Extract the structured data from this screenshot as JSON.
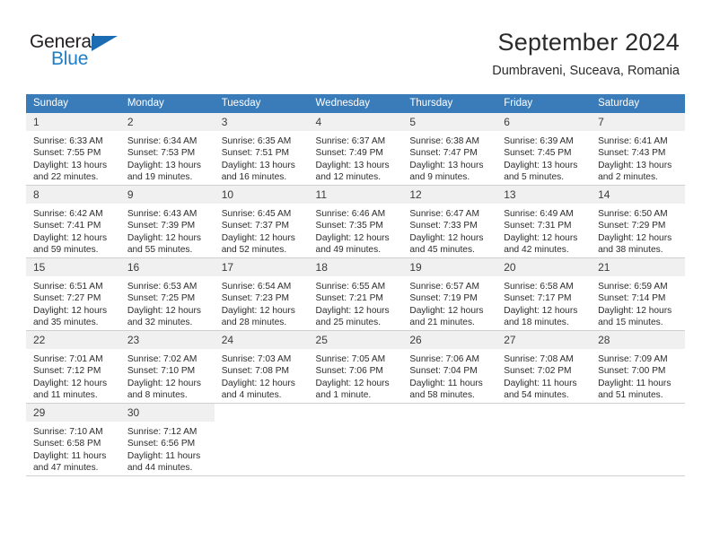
{
  "brand": {
    "name_dark": "General",
    "name_blue": "Blue",
    "flag_icon": "blue-triangle-flag",
    "dark_color": "#231f20",
    "blue_color": "#1f7ec4"
  },
  "header": {
    "title": "September 2024",
    "subtitle": "Dumbraveni, Suceava, Romania"
  },
  "theme": {
    "header_blue": "#3a7cb9",
    "daynum_bg": "#f0f0f0",
    "row_border": "#cfcfcf"
  },
  "weekday_headers": [
    "Sunday",
    "Monday",
    "Tuesday",
    "Wednesday",
    "Thursday",
    "Friday",
    "Saturday"
  ],
  "weeks": [
    [
      {
        "day": "1",
        "sunrise": "Sunrise: 6:33 AM",
        "sunset": "Sunset: 7:55 PM",
        "daylight": "Daylight: 13 hours and 22 minutes."
      },
      {
        "day": "2",
        "sunrise": "Sunrise: 6:34 AM",
        "sunset": "Sunset: 7:53 PM",
        "daylight": "Daylight: 13 hours and 19 minutes."
      },
      {
        "day": "3",
        "sunrise": "Sunrise: 6:35 AM",
        "sunset": "Sunset: 7:51 PM",
        "daylight": "Daylight: 13 hours and 16 minutes."
      },
      {
        "day": "4",
        "sunrise": "Sunrise: 6:37 AM",
        "sunset": "Sunset: 7:49 PM",
        "daylight": "Daylight: 13 hours and 12 minutes."
      },
      {
        "day": "5",
        "sunrise": "Sunrise: 6:38 AM",
        "sunset": "Sunset: 7:47 PM",
        "daylight": "Daylight: 13 hours and 9 minutes."
      },
      {
        "day": "6",
        "sunrise": "Sunrise: 6:39 AM",
        "sunset": "Sunset: 7:45 PM",
        "daylight": "Daylight: 13 hours and 5 minutes."
      },
      {
        "day": "7",
        "sunrise": "Sunrise: 6:41 AM",
        "sunset": "Sunset: 7:43 PM",
        "daylight": "Daylight: 13 hours and 2 minutes."
      }
    ],
    [
      {
        "day": "8",
        "sunrise": "Sunrise: 6:42 AM",
        "sunset": "Sunset: 7:41 PM",
        "daylight": "Daylight: 12 hours and 59 minutes."
      },
      {
        "day": "9",
        "sunrise": "Sunrise: 6:43 AM",
        "sunset": "Sunset: 7:39 PM",
        "daylight": "Daylight: 12 hours and 55 minutes."
      },
      {
        "day": "10",
        "sunrise": "Sunrise: 6:45 AM",
        "sunset": "Sunset: 7:37 PM",
        "daylight": "Daylight: 12 hours and 52 minutes."
      },
      {
        "day": "11",
        "sunrise": "Sunrise: 6:46 AM",
        "sunset": "Sunset: 7:35 PM",
        "daylight": "Daylight: 12 hours and 49 minutes."
      },
      {
        "day": "12",
        "sunrise": "Sunrise: 6:47 AM",
        "sunset": "Sunset: 7:33 PM",
        "daylight": "Daylight: 12 hours and 45 minutes."
      },
      {
        "day": "13",
        "sunrise": "Sunrise: 6:49 AM",
        "sunset": "Sunset: 7:31 PM",
        "daylight": "Daylight: 12 hours and 42 minutes."
      },
      {
        "day": "14",
        "sunrise": "Sunrise: 6:50 AM",
        "sunset": "Sunset: 7:29 PM",
        "daylight": "Daylight: 12 hours and 38 minutes."
      }
    ],
    [
      {
        "day": "15",
        "sunrise": "Sunrise: 6:51 AM",
        "sunset": "Sunset: 7:27 PM",
        "daylight": "Daylight: 12 hours and 35 minutes."
      },
      {
        "day": "16",
        "sunrise": "Sunrise: 6:53 AM",
        "sunset": "Sunset: 7:25 PM",
        "daylight": "Daylight: 12 hours and 32 minutes."
      },
      {
        "day": "17",
        "sunrise": "Sunrise: 6:54 AM",
        "sunset": "Sunset: 7:23 PM",
        "daylight": "Daylight: 12 hours and 28 minutes."
      },
      {
        "day": "18",
        "sunrise": "Sunrise: 6:55 AM",
        "sunset": "Sunset: 7:21 PM",
        "daylight": "Daylight: 12 hours and 25 minutes."
      },
      {
        "day": "19",
        "sunrise": "Sunrise: 6:57 AM",
        "sunset": "Sunset: 7:19 PM",
        "daylight": "Daylight: 12 hours and 21 minutes."
      },
      {
        "day": "20",
        "sunrise": "Sunrise: 6:58 AM",
        "sunset": "Sunset: 7:17 PM",
        "daylight": "Daylight: 12 hours and 18 minutes."
      },
      {
        "day": "21",
        "sunrise": "Sunrise: 6:59 AM",
        "sunset": "Sunset: 7:14 PM",
        "daylight": "Daylight: 12 hours and 15 minutes."
      }
    ],
    [
      {
        "day": "22",
        "sunrise": "Sunrise: 7:01 AM",
        "sunset": "Sunset: 7:12 PM",
        "daylight": "Daylight: 12 hours and 11 minutes."
      },
      {
        "day": "23",
        "sunrise": "Sunrise: 7:02 AM",
        "sunset": "Sunset: 7:10 PM",
        "daylight": "Daylight: 12 hours and 8 minutes."
      },
      {
        "day": "24",
        "sunrise": "Sunrise: 7:03 AM",
        "sunset": "Sunset: 7:08 PM",
        "daylight": "Daylight: 12 hours and 4 minutes."
      },
      {
        "day": "25",
        "sunrise": "Sunrise: 7:05 AM",
        "sunset": "Sunset: 7:06 PM",
        "daylight": "Daylight: 12 hours and 1 minute."
      },
      {
        "day": "26",
        "sunrise": "Sunrise: 7:06 AM",
        "sunset": "Sunset: 7:04 PM",
        "daylight": "Daylight: 11 hours and 58 minutes."
      },
      {
        "day": "27",
        "sunrise": "Sunrise: 7:08 AM",
        "sunset": "Sunset: 7:02 PM",
        "daylight": "Daylight: 11 hours and 54 minutes."
      },
      {
        "day": "28",
        "sunrise": "Sunrise: 7:09 AM",
        "sunset": "Sunset: 7:00 PM",
        "daylight": "Daylight: 11 hours and 51 minutes."
      }
    ],
    [
      {
        "day": "29",
        "sunrise": "Sunrise: 7:10 AM",
        "sunset": "Sunset: 6:58 PM",
        "daylight": "Daylight: 11 hours and 47 minutes."
      },
      {
        "day": "30",
        "sunrise": "Sunrise: 7:12 AM",
        "sunset": "Sunset: 6:56 PM",
        "daylight": "Daylight: 11 hours and 44 minutes."
      },
      {
        "day": "",
        "sunrise": "",
        "sunset": "",
        "daylight": ""
      },
      {
        "day": "",
        "sunrise": "",
        "sunset": "",
        "daylight": ""
      },
      {
        "day": "",
        "sunrise": "",
        "sunset": "",
        "daylight": ""
      },
      {
        "day": "",
        "sunrise": "",
        "sunset": "",
        "daylight": ""
      },
      {
        "day": "",
        "sunrise": "",
        "sunset": "",
        "daylight": ""
      }
    ]
  ]
}
